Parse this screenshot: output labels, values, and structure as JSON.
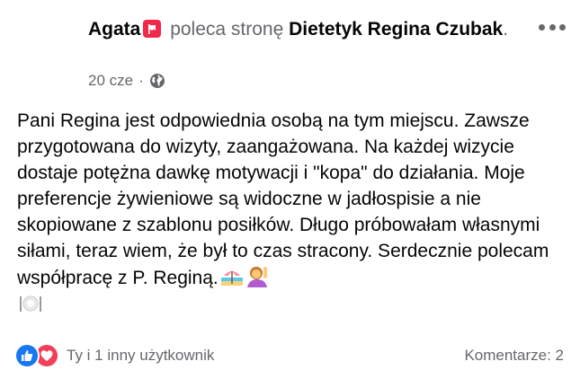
{
  "post": {
    "author": "Agata",
    "recommend_icon": "recommend-flag-icon",
    "verb": "poleca stronę",
    "page_name_line1": "Dietetyk Regina",
    "page_name_line2": "Czubak",
    "period": ".",
    "timestamp": "20 cze",
    "meta_separator": "·",
    "privacy_icon": "globe-icon",
    "body": "Pani Regina jest odpowiednia osobą na tym miejscu. Zawsze przygotowana do wizyty, zaangażowana. Na każdej wizycie dostaje potężna dawkę motywacji i \"kopa\" do działania. Moje preferencje żywieniowe są widoczne w jadłospisie a nie skopiowane z szablonu posiłków. Długo próbowałam własnymi siłami, teraz wiem, że był to czas stracony. Serdecznie polecam współpracę z P. Reginą.",
    "emojis": [
      "beach-umbrella-icon",
      "woman-raising-hand-icon",
      "plate-cutlery-icon"
    ]
  },
  "reactions": {
    "icons": [
      "like-icon",
      "love-icon"
    ],
    "summary": "Ty i 1 inny użytkownik"
  },
  "comments": {
    "label": "Komentarze: 2"
  },
  "colors": {
    "recommend_red": "#f02849",
    "like_blue": "#1877f2",
    "love_red": "#f33e58",
    "secondary_text": "#65676b"
  }
}
